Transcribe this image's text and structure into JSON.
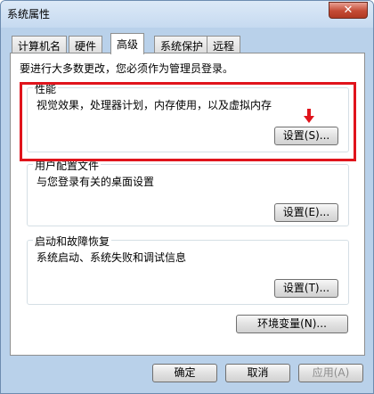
{
  "window": {
    "title": "系统属性",
    "close_label": "✕"
  },
  "tabs": [
    {
      "label": "计算机名"
    },
    {
      "label": "硬件"
    },
    {
      "label": "高级"
    },
    {
      "label": "系统保护"
    },
    {
      "label": "远程"
    }
  ],
  "active_tab": "高级",
  "admin_note": "要进行大多数更改，您必须作为管理员登录。",
  "performance": {
    "title": "性能",
    "description": "视觉效果，处理器计划，内存使用，以及虚拟内存",
    "settings_label": "设置(S)..."
  },
  "user_profiles": {
    "title": "用户配置文件",
    "description": "与您登录有关的桌面设置",
    "settings_label": "设置(E)..."
  },
  "startup_recovery": {
    "title": "启动和故障恢复",
    "description": "系统启动、系统失败和调试信息",
    "settings_label": "设置(T)..."
  },
  "env_vars_label": "环境变量(N)...",
  "footer": {
    "ok_label": "确定",
    "cancel_label": "取消",
    "apply_label": "应用(A)"
  },
  "colors": {
    "highlight_border": "#e0141c",
    "arrow": "#e0141c"
  }
}
